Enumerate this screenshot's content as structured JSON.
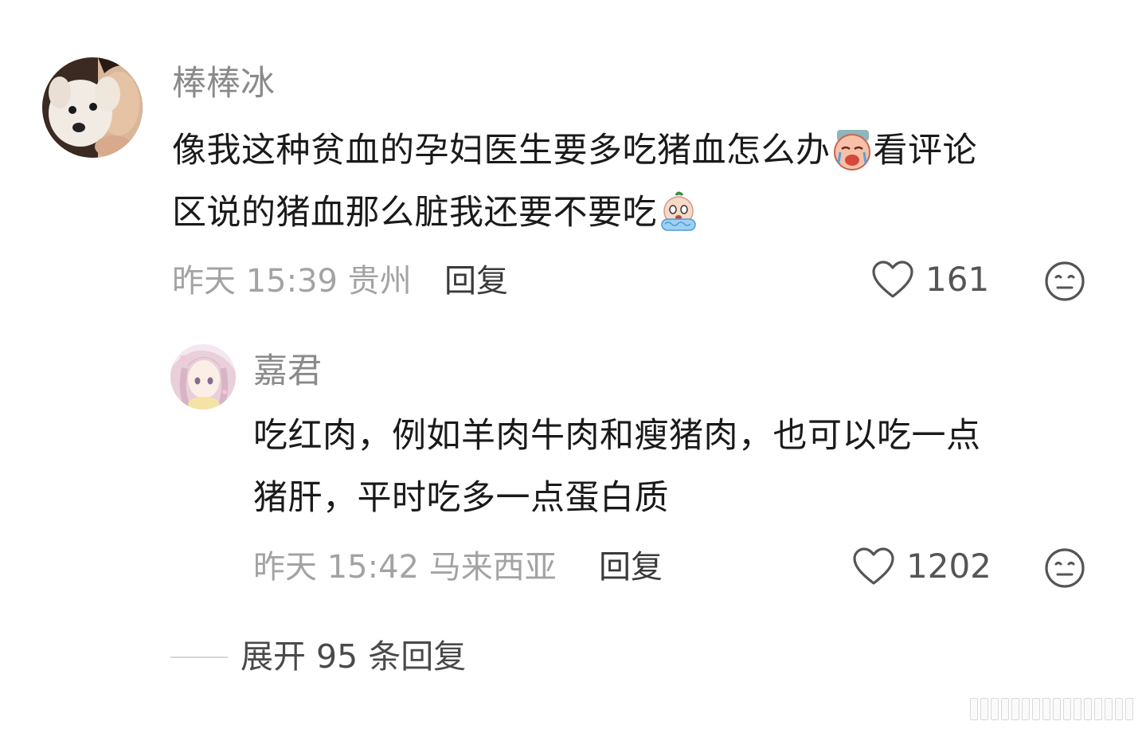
{
  "comments": [
    {
      "username": "棒棒冰",
      "avatar_icon": "avatar-dog-photo",
      "text_line1": "像我这种贫血的孕妇医生要多吃猪血怎么办",
      "emoji1": "crying-face-emoji",
      "text_line1_tail": "看评论",
      "text_line2": "区说的猪血那么脏我还要不要吃",
      "emoji2": "scared-crying-emoji",
      "time": "昨天 15:39",
      "location": "贵州",
      "reply_label": "回复",
      "like_count": "161"
    },
    {
      "username": "嘉君",
      "avatar_icon": "avatar-anime-girl",
      "text_line1": "吃红肉，例如羊肉牛肉和瘦猪肉，也可以吃一点",
      "text_line2": "猪肝，平时吃多一点蛋白质",
      "time": "昨天 15:42",
      "location": "马来西亚",
      "reply_label": "回复",
      "like_count": "1202"
    }
  ],
  "expand_replies": {
    "label": "展开 95 条回复"
  },
  "colors": {
    "username": "#8a8a8a",
    "meta": "#a3a3a3",
    "text": "#1a1a1a",
    "icon": "#555555"
  }
}
